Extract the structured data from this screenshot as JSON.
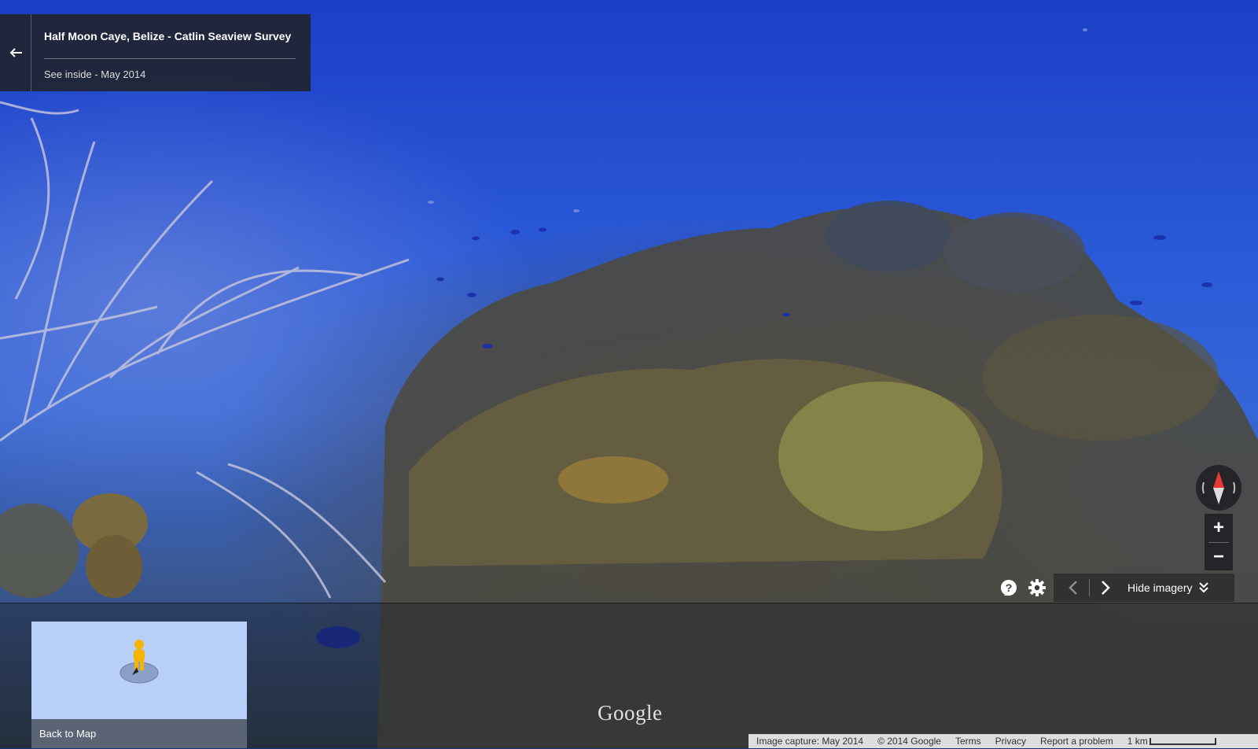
{
  "info_card": {
    "title": "Half Moon Caye, Belize - Catlin Seaview Survey",
    "subtitle": "See inside - May 2014"
  },
  "minimap": {
    "label": "Back to Map"
  },
  "controls": {
    "zoom_in": "+",
    "zoom_out": "−",
    "hide_imagery": "Hide imagery"
  },
  "watermark": "Google",
  "footer": {
    "capture": "Image capture: May 2014",
    "copyright": "© 2014 Google",
    "terms": "Terms",
    "privacy": "Privacy",
    "report": "Report a problem",
    "scale": "1 km"
  },
  "colors": {
    "water": "#2a5ad8",
    "panel": "#212530",
    "minimap_bg": "#b8cff8",
    "compass_north": "#e53935",
    "pegman": "#f4b400"
  },
  "icons": [
    "back-arrow-icon",
    "pegman-icon",
    "compass-icon",
    "help-icon",
    "gear-icon",
    "chevron-left-icon",
    "chevron-right-icon",
    "double-chevron-down-icon"
  ]
}
